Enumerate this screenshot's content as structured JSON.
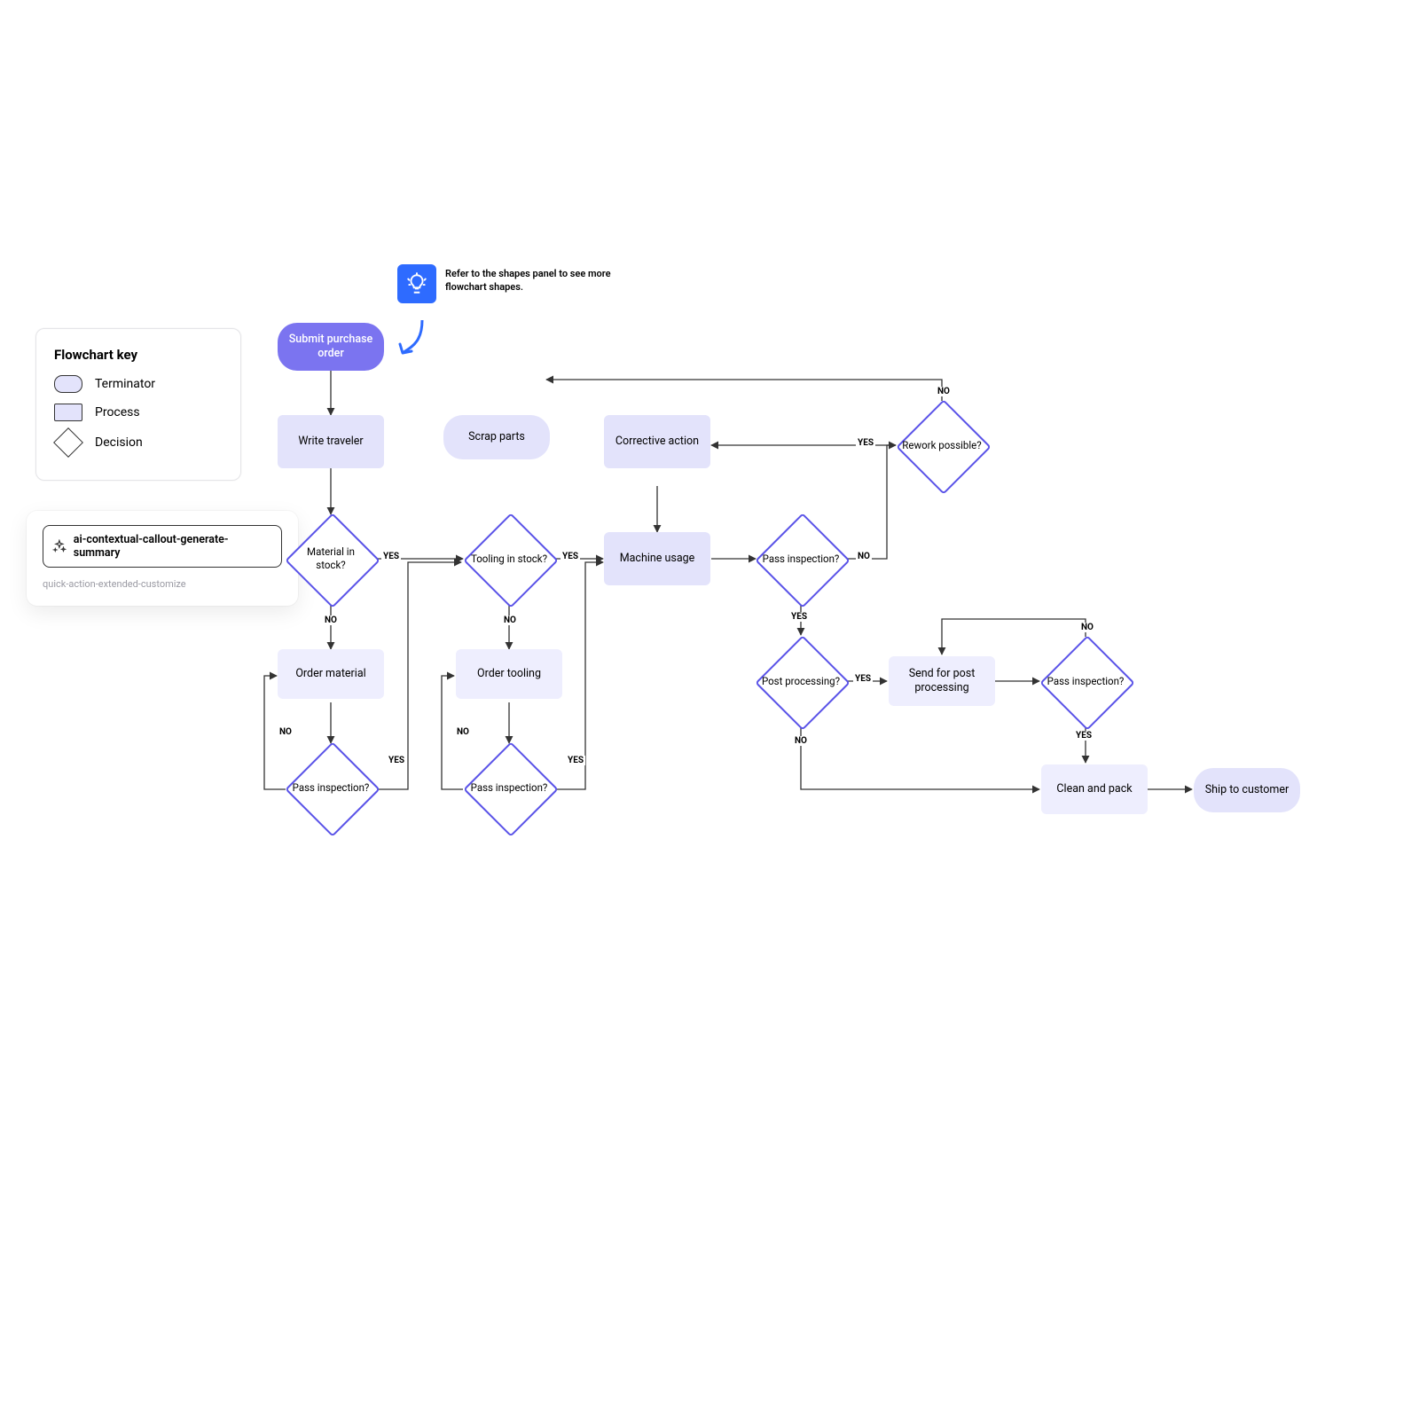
{
  "legend": {
    "title": "Flowchart key",
    "terminator": "Terminator",
    "process": "Process",
    "decision": "Decision"
  },
  "ai": {
    "button_label": "ai-contextual-callout-generate-summary",
    "subtext": "quick-action-extended-customize"
  },
  "tip": {
    "text": "Refer to the shapes panel to see more flowchart shapes."
  },
  "nodes": {
    "submit_po": "Submit purchase order",
    "write_traveler": "Write traveler",
    "material_stock": "Material in stock?",
    "order_material": "Order material",
    "pass_inspection_a": "Pass inspection?",
    "tooling_stock": "Tooling in stock?",
    "order_tooling": "Order tooling",
    "pass_inspection_b": "Pass inspection?",
    "scrap_parts": "Scrap parts",
    "corrective_action": "Corrective action",
    "machine_usage": "Machine usage",
    "pass_inspection_c": "Pass inspection?",
    "rework_possible": "Rework possible?",
    "post_processing": "Post processing?",
    "send_post_processing": "Send for post processing",
    "pass_inspection_d": "Pass inspection?",
    "clean_pack": "Clean and pack",
    "ship_customer": "Ship to customer"
  },
  "labels": {
    "yes": "YES",
    "no": "NO"
  }
}
